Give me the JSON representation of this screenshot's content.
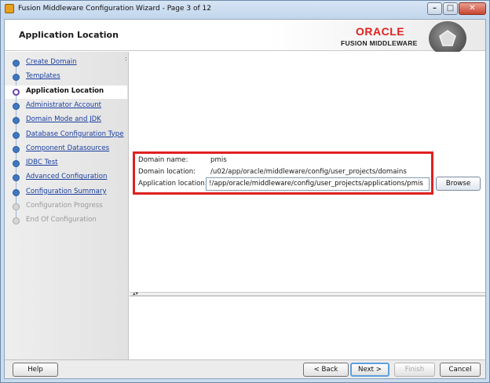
{
  "window": {
    "title": "Fusion Middleware Configuration Wizard - Page 3 of 12",
    "controls": {
      "minimize": "–",
      "maximize": "□",
      "close": "✕"
    }
  },
  "header": {
    "page_title": "Application Location",
    "brand": "ORACLE",
    "product": "FUSION MIDDLEWARE",
    "badge_icon": "pentagon-icon"
  },
  "nav": {
    "items": [
      {
        "label": "Create Domain",
        "state": "done"
      },
      {
        "label": "Templates",
        "state": "done"
      },
      {
        "label": "Application Location",
        "state": "current"
      },
      {
        "label": "Administrator Account",
        "state": "done"
      },
      {
        "label": "Domain Mode and JDK",
        "state": "done"
      },
      {
        "label": "Database Configuration Type",
        "state": "done"
      },
      {
        "label": "Component Datasources",
        "state": "done"
      },
      {
        "label": "JDBC Test",
        "state": "done"
      },
      {
        "label": "Advanced Configuration",
        "state": "done"
      },
      {
        "label": "Configuration Summary",
        "state": "done"
      },
      {
        "label": "Configuration Progress",
        "state": "pending"
      },
      {
        "label": "End Of Configuration",
        "state": "pending"
      }
    ]
  },
  "form": {
    "domain_name_label": "Domain name:",
    "domain_name_value": "pmis",
    "domain_location_label": "Domain location:",
    "domain_location_value": "/u02/app/oracle/middleware/config/user_projects/domains",
    "app_location_label": "Application location:",
    "app_location_value": "!/app/oracle/middleware/config/user_projects/applications/pmis",
    "browse_label": "Browse"
  },
  "footer": {
    "help": "Help",
    "back": "< Back",
    "next": "Next >",
    "finish": "Finish",
    "cancel": "Cancel"
  },
  "colors": {
    "highlight": "#e02020",
    "oracle_red": "#e01f1f",
    "nav_link": "#1a3ea0"
  }
}
